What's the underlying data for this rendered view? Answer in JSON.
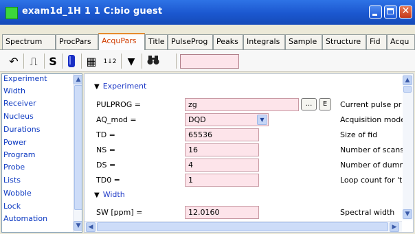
{
  "window": {
    "title": "exam1d_1H  1  1  C:bio  guest"
  },
  "tabs": [
    {
      "label": "Spectrum"
    },
    {
      "label": "ProcPars"
    },
    {
      "label": "AcquPars"
    },
    {
      "label": "Title"
    },
    {
      "label": "PulseProg"
    },
    {
      "label": "Peaks"
    },
    {
      "label": "Integrals"
    },
    {
      "label": "Sample"
    },
    {
      "label": "Structure"
    },
    {
      "label": "Fid"
    },
    {
      "label": "Acqu"
    }
  ],
  "active_tab": "AcquPars",
  "toolbar": {
    "undo_icon": "↶",
    "pulse_icon": "⎍",
    "s_label": "S",
    "probe_icon": "probe-icon",
    "table_icon": "▦",
    "sort_icon": "1↓2",
    "filter_icon": "▼",
    "find_icon": "binoculars-icon",
    "search_value": ""
  },
  "sidebar": {
    "items": [
      {
        "label": "Experiment"
      },
      {
        "label": "Width"
      },
      {
        "label": "Receiver"
      },
      {
        "label": "Nucleus"
      },
      {
        "label": "Durations"
      },
      {
        "label": "Power"
      },
      {
        "label": "Program"
      },
      {
        "label": "Probe"
      },
      {
        "label": "Lists"
      },
      {
        "label": "Wobble"
      },
      {
        "label": "Lock"
      },
      {
        "label": "Automation"
      }
    ]
  },
  "sections": {
    "experiment": "Experiment",
    "width": "Width"
  },
  "params": [
    {
      "name": "PULPROG =",
      "value": "zg",
      "desc": "Current pulse pr"
    },
    {
      "name": "AQ_mod =",
      "value": "DQD",
      "desc": "Acquisition mode"
    },
    {
      "name": "TD =",
      "value": "65536",
      "desc": "Size of fid"
    },
    {
      "name": "NS =",
      "value": "16",
      "desc": "Number of scans"
    },
    {
      "name": "DS =",
      "value": "4",
      "desc": "Number of dumm"
    },
    {
      "name": "TD0 =",
      "value": "1",
      "desc": "Loop count for 't"
    },
    {
      "name": "SW [ppm] =",
      "value": "12.0160",
      "desc": "Spectral width"
    }
  ],
  "buttons": {
    "browse": "...",
    "edit": "E"
  },
  "colors": {
    "titlebar": "#1b57cf",
    "active_tab_text": "#d03c00",
    "field_bg": "#fde4ea",
    "link_blue": "#0b38c1"
  }
}
